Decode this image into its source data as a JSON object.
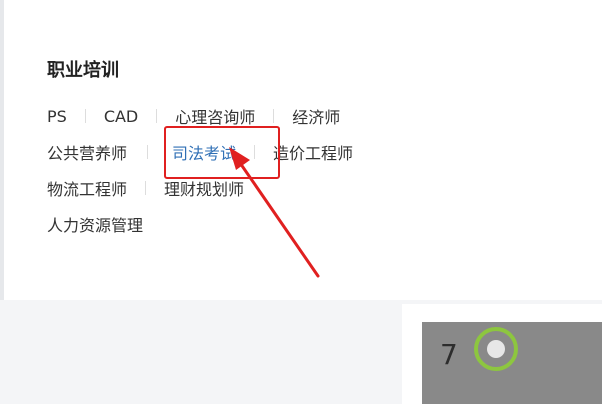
{
  "section": {
    "title": "职业培训",
    "rows": [
      [
        "PS",
        "CAD",
        "心理咨询师",
        "经济师"
      ],
      [
        "公共营养师",
        "司法考试",
        "造价工程师"
      ],
      [
        "物流工程师",
        "理财规划师"
      ],
      [
        "人力资源管理"
      ]
    ],
    "active_item": "司法考试"
  },
  "card": {
    "number": "7"
  },
  "colors": {
    "highlight": "#e02020",
    "active_link": "#2f6fb5",
    "text": "#333333"
  }
}
